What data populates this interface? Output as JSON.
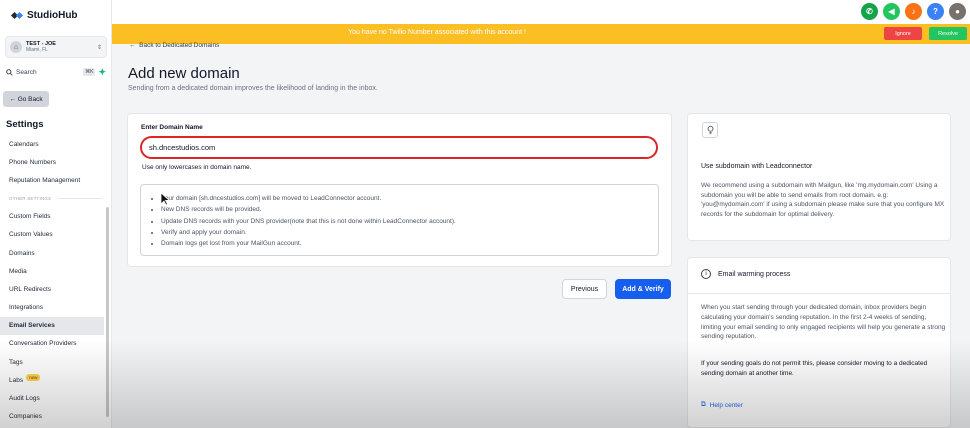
{
  "app": {
    "name": "StudioHub"
  },
  "account": {
    "name": "TEST - JOE",
    "location": "Miami, FL"
  },
  "search": {
    "label": "Search",
    "shortcut": "⌘K"
  },
  "sidebar": {
    "back_label": "Go Back",
    "title": "Settings",
    "items": [
      {
        "label": "Calendars"
      },
      {
        "label": "Phone Numbers"
      },
      {
        "label": "Reputation Management"
      },
      {
        "label": "OTHER SETTINGS",
        "section": true
      },
      {
        "label": "Custom Fields"
      },
      {
        "label": "Custom Values"
      },
      {
        "label": "Domains"
      },
      {
        "label": "Media"
      },
      {
        "label": "URL Redirects"
      },
      {
        "label": "Integrations"
      },
      {
        "label": "Email Services",
        "active": true
      },
      {
        "label": "Conversation Providers"
      },
      {
        "label": "Tags"
      },
      {
        "label": "Labs",
        "badge": "new"
      },
      {
        "label": "Audit Logs"
      },
      {
        "label": "Companies"
      }
    ]
  },
  "banner": {
    "text": "You have no Twilio Number associated with this account !",
    "ignore_label": "Ignore",
    "resolve_label": "Resolve",
    "color": "#fbbf24"
  },
  "page": {
    "back_link": "Back to Dedicated Domains",
    "title": "Add new domain",
    "subtitle": "Sending from a dedicated domain improves the likelihood of landing in the inbox."
  },
  "form": {
    "label": "Enter Domain Name",
    "value": "sh.dncestudios.com",
    "hint": "Use only lowercases in domain name.",
    "notes": [
      "Your domain [sh.dncestudios.com] will be moved to LeadConnector account.",
      "New DNS records will be provided.",
      "Update DNS records with your DNS provider(note that this is not done within LeadConnector account).",
      "Verify and apply your domain.",
      "Domain logs get lost from your MailGun account."
    ],
    "previous_label": "Previous",
    "verify_label": "Add & Verify",
    "accent": "#155eef"
  },
  "tip": {
    "title": "Use subdomain with Leadconnector",
    "body": "We recommend using a subdomain with Mailgun, like 'mg.mydomain.com' Using a subdomain you will be able to send emails from root domain. e.g: 'you@mydomain.com' if using a subdomain please make sure that you configure MX records for the subdomain for optimal delivery."
  },
  "warming": {
    "title": "Email warming process",
    "body": "When you start sending through your dedicated domain, inbox providers begin calculating your domain's sending reputation. In the first 2-4 weeks of sending, limiting your email sending to only engaged recipients will help you generate a strong sending reputation.",
    "note": "If your sending goals do not permit this, please consider moving to a dedicated sending domain at another time.",
    "help_label": "Help center"
  }
}
